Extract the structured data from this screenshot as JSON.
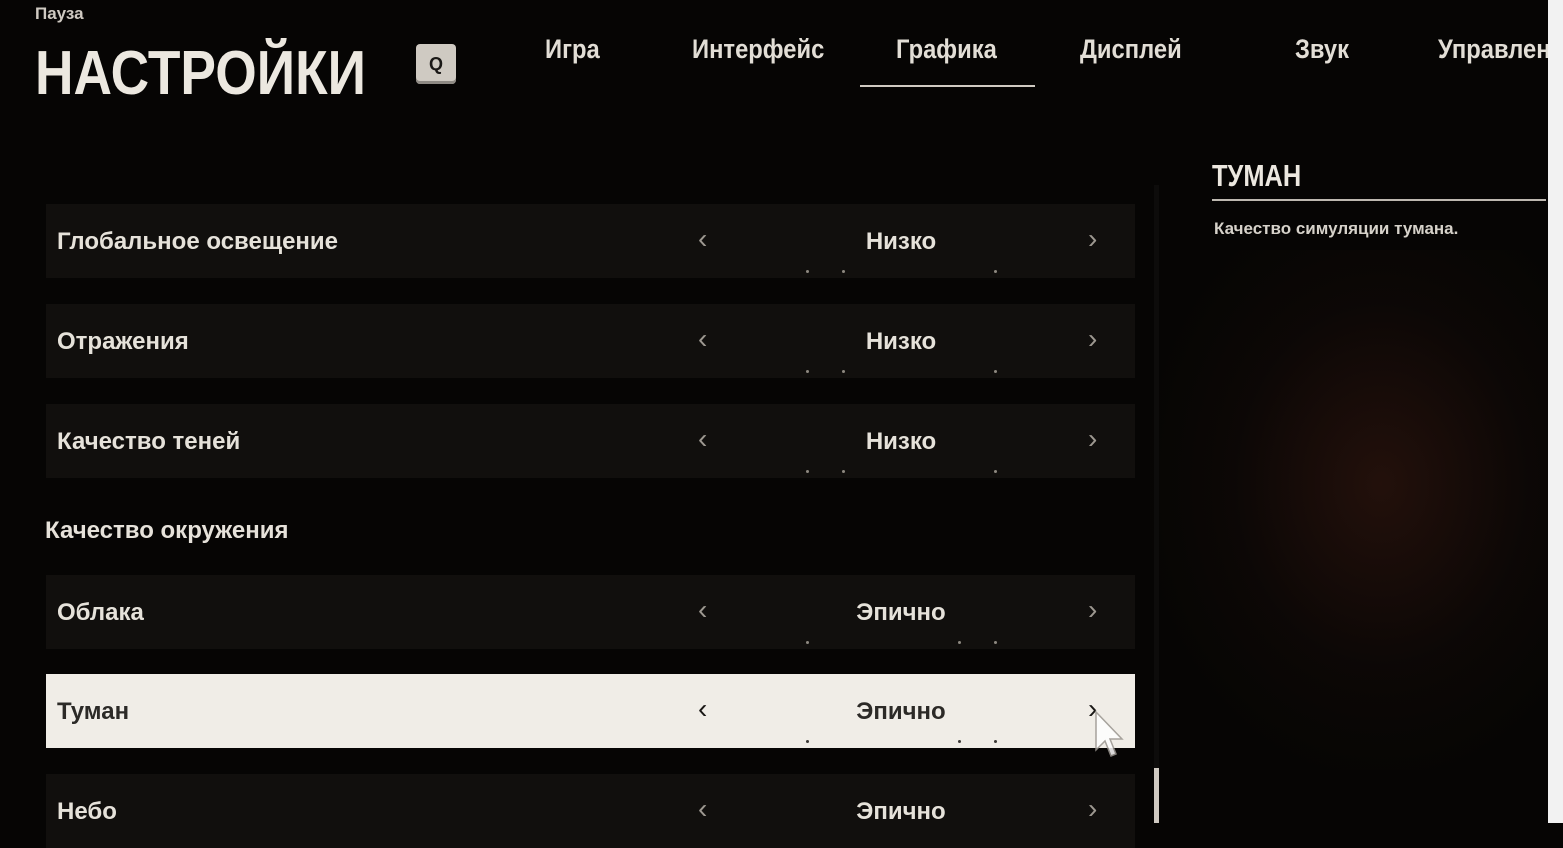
{
  "header": {
    "breadcrumb": "Пауза",
    "title": "НАСТРОЙКИ",
    "tab_key_left": "Q"
  },
  "tabs": [
    {
      "label": "Игра",
      "active": false
    },
    {
      "label": "Интерфейс",
      "active": false
    },
    {
      "label": "Графика",
      "active": true
    },
    {
      "label": "Дисплей",
      "active": false
    },
    {
      "label": "Звук",
      "active": false
    },
    {
      "label": "Управлен",
      "active": false
    }
  ],
  "settings": {
    "rows": [
      {
        "label": "Глобальное освещение",
        "value": "Низко"
      },
      {
        "label": "Отражения",
        "value": "Низко"
      },
      {
        "label": "Качество теней",
        "value": "Низко"
      }
    ],
    "section_heading": "Качество окружения",
    "section_rows": [
      {
        "label": "Облака",
        "value": "Эпично"
      },
      {
        "label": "Туман",
        "value": "Эпично",
        "selected": true
      },
      {
        "label": "Небо",
        "value": "Эпично"
      }
    ],
    "arrow_left": "‹",
    "arrow_right": "›"
  },
  "info_panel": {
    "title": "ТУМАН",
    "description": "Качество симуляции тумана."
  },
  "colors": {
    "background": "#060504",
    "row_background": "#110f0d",
    "selected_row": "#f0ede7",
    "text": "#e6e2da"
  },
  "icons": {
    "arrow_left": "chevron-left-icon",
    "arrow_right": "chevron-right-icon",
    "cursor": "mouse-cursor-icon"
  }
}
